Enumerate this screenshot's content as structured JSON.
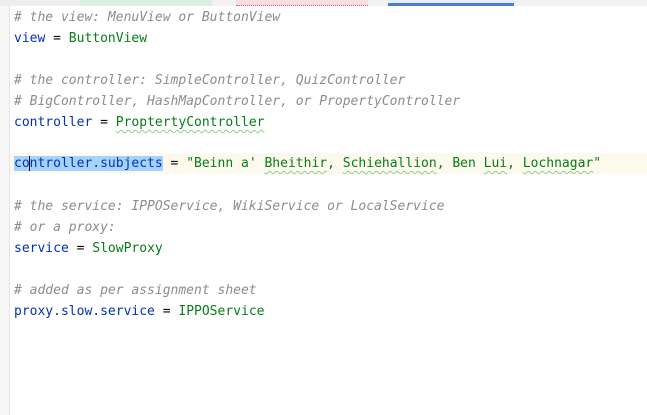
{
  "colors": {
    "comment": "#8c8c8c",
    "key": "#0033b3",
    "value": "#067d17",
    "selection": "#a6d2ff",
    "caret_line": "#fcfaed",
    "tab_green": "#c8e6c9",
    "tab_red": "#f5c2c2",
    "tab_blue": "#4a7fcf"
  },
  "lines": {
    "l1_comment": "# the view: MenuView or ButtonView",
    "l2_key": "view",
    "l2_eq": " = ",
    "l2_value": "ButtonView",
    "l4_comment": "# the controller: SimpleController, QuizController",
    "l5_comment": "# BigController, HashMapController, or PropertyController",
    "l6_key": "controller",
    "l6_eq": " = ",
    "l6_value": "ProptertyController",
    "l8_key_sel_a": "co",
    "l8_key_sel_b": "ntroller.subjects",
    "l8_eq": " = ",
    "l8_value_pre": "\"Beinn a' ",
    "l8_value_typo1": "Bheithir",
    "l8_value_mid1": ", ",
    "l8_value_typo2": "Schiehallion",
    "l8_value_mid2": ", Ben ",
    "l8_value_typo3": "Lui",
    "l8_value_mid3": ", ",
    "l8_value_typo4": "Lochnagar",
    "l8_value_post": "\"",
    "l10_comment": "# the service: IPPOService, WikiService or LocalService",
    "l11_comment": "# or a proxy:",
    "l12_key": "service",
    "l12_eq": " = ",
    "l12_value": "SlowProxy",
    "l14_comment": "# added as per assignment sheet",
    "l15_key": "proxy.slow.service",
    "l15_eq": " = ",
    "l15_value": "IPPOService"
  }
}
